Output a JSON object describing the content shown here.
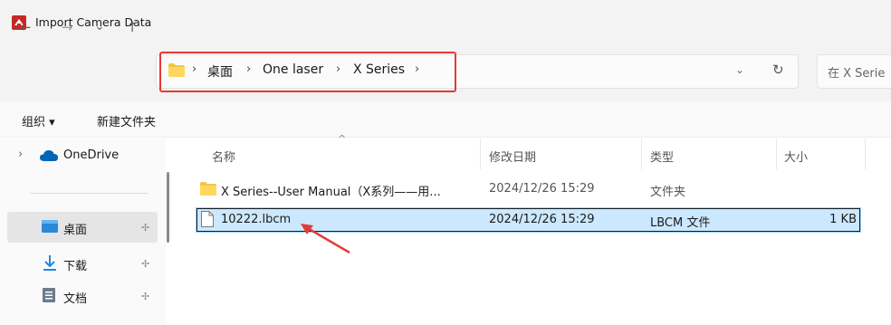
{
  "window": {
    "title": "Import Camera Data"
  },
  "nav": {
    "back": "←",
    "forward": "→",
    "recent": "⌄",
    "up": "↑"
  },
  "address": {
    "crumbs": [
      "桌面",
      "One laser",
      "X Series"
    ],
    "separator": "›",
    "dropdown": "⌄",
    "refresh": "↻",
    "search_placeholder": "在 X Serie"
  },
  "command": {
    "organize": "组织 ▾",
    "new_folder": "新建文件夹"
  },
  "sidebar": {
    "expand": "›",
    "onedrive": "OneDrive",
    "desktop": "桌面",
    "downloads": "下载",
    "documents": "文档",
    "pin": "📌"
  },
  "columns": {
    "name": "名称",
    "modified": "修改日期",
    "type": "类型",
    "size": "大小",
    "sort_caret": "^"
  },
  "rows": [
    {
      "name": "X Series--User Manual（X系列——用...",
      "modified": "2024/12/26 15:29",
      "type": "文件夹",
      "size": ""
    },
    {
      "name": "10222.lbcm",
      "modified": "2024/12/26 15:29",
      "type": "LBCM 文件",
      "size": "1 KB"
    }
  ],
  "colors": {
    "highlight": "#e53935",
    "selection": "#cce8ff",
    "accent": "#0078d4"
  }
}
